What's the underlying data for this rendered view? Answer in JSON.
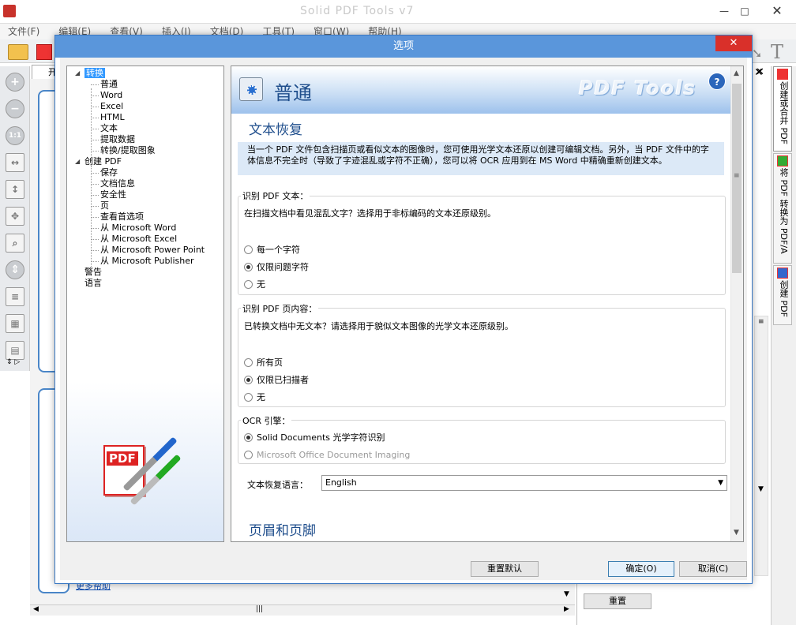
{
  "app": {
    "title": "Solid PDF Tools v7",
    "menu": [
      "文件(F)",
      "编辑(E)",
      "查看(V)",
      "插入(I)",
      "文档(D)",
      "工具(T)",
      "窗口(W)",
      "帮助(H)"
    ],
    "tab_fragment": "开",
    "scroll_link_text": "更多帮助",
    "reset_button": "重置",
    "side_label_fragment": "式"
  },
  "right_tabs": [
    "创建或合并 PDF",
    "将 PDF 转换为 PDF/A",
    "创建 PDF"
  ],
  "dialog": {
    "title": "选项",
    "tree": {
      "items": [
        {
          "label": "转换",
          "level": 0,
          "selected": true,
          "expander": "◢"
        },
        {
          "label": "普通",
          "level": 1
        },
        {
          "label": "Word",
          "level": 1
        },
        {
          "label": "Excel",
          "level": 1
        },
        {
          "label": "HTML",
          "level": 1
        },
        {
          "label": "文本",
          "level": 1
        },
        {
          "label": "提取数据",
          "level": 1
        },
        {
          "label": "转换/提取图象",
          "level": 1
        },
        {
          "label": "创建 PDF",
          "level": 0,
          "expander": "◢"
        },
        {
          "label": "保存",
          "level": 1
        },
        {
          "label": "文档信息",
          "level": 1
        },
        {
          "label": "安全性",
          "level": 1
        },
        {
          "label": "页",
          "level": 1
        },
        {
          "label": "查看首选项",
          "level": 1
        },
        {
          "label": "从 Microsoft Word",
          "level": 1
        },
        {
          "label": "从 Microsoft Excel",
          "level": 1
        },
        {
          "label": "从 Microsoft Power Point",
          "level": 1
        },
        {
          "label": "从 Microsoft Publisher",
          "level": 1
        },
        {
          "label": "警告",
          "level": 0
        },
        {
          "label": "语言",
          "level": 0
        }
      ]
    },
    "content": {
      "header_title": "普通",
      "brand": "PDF Tools",
      "help_glyph": "?",
      "section_text_recovery": "文本恢复",
      "description": "当一个 PDF 文件包含扫描页或看似文本的图像时，您可使用光学文本还原以创建可编辑文档。另外，当 PDF 文件中的字体信息不完全时（导致了字迹混乱或字符不正确），您可以将 OCR 应用到在 MS Word 中精确重新创建文本。",
      "group_identify_text": {
        "label": "识别 PDF 文本：",
        "desc": "在扫描文档中看见混乱文字？选择用于非标编码的文本还原级别。",
        "options": [
          "每一个字符",
          "仅限问题字符",
          "无"
        ],
        "selected": 1
      },
      "group_identify_page": {
        "label": "识别 PDF 页内容：",
        "desc": "已转换文档中无文本？请选择用于貌似文本图像的光学文本还原级别。",
        "options": [
          "所有页",
          "仅限已扫描者",
          "无"
        ],
        "selected": 1
      },
      "group_ocr": {
        "label": "OCR 引擎：",
        "options": [
          "Solid Documents 光学字符识别",
          "Microsoft Office Document Imaging"
        ],
        "selected": 0,
        "disabled": [
          1
        ]
      },
      "language": {
        "label": "文本恢复语言：",
        "value": "English"
      },
      "section_header_footer": "页眉和页脚"
    },
    "buttons": {
      "reset_defaults": "重置默认",
      "ok": "确定(O)",
      "cancel": "取消(C)"
    },
    "logo_text": "PDF"
  }
}
